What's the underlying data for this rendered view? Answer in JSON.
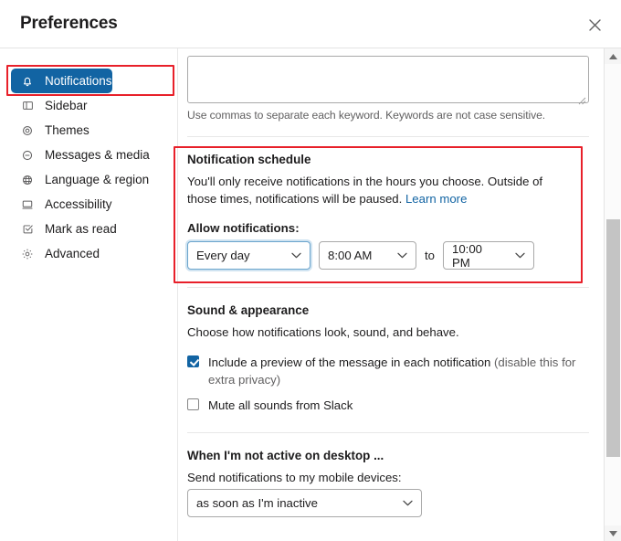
{
  "window": {
    "title": "Preferences",
    "close_icon": "close-icon"
  },
  "sidebar": {
    "items": [
      {
        "label": "Notifications",
        "icon": "bell-icon",
        "selected": true
      },
      {
        "label": "Sidebar",
        "icon": "sidebar-icon",
        "selected": false
      },
      {
        "label": "Themes",
        "icon": "eye-icon",
        "selected": false
      },
      {
        "label": "Messages & media",
        "icon": "message-icon",
        "selected": false
      },
      {
        "label": "Language & region",
        "icon": "globe-icon",
        "selected": false
      },
      {
        "label": "Accessibility",
        "icon": "keyboard-icon",
        "selected": false
      },
      {
        "label": "Mark as read",
        "icon": "checkmark-box-icon",
        "selected": false
      },
      {
        "label": "Advanced",
        "icon": "gear-icon",
        "selected": false
      }
    ]
  },
  "main": {
    "keywords": {
      "value": "",
      "placeholder": "",
      "hint": "Use commas to separate each keyword. Keywords are not case sensitive."
    },
    "notification_schedule": {
      "title": "Notification schedule",
      "description_part1": "You'll only receive notifications in the hours you choose. Outside of those times, notifications will be paused. ",
      "learn_more": "Learn more",
      "allow_label": "Allow notifications:",
      "days_value": "Every day",
      "start_time": "8:00 AM",
      "to_label": "to",
      "end_time": "10:00 PM"
    },
    "sound_appearance": {
      "title": "Sound & appearance",
      "description": "Choose how notifications look, sound, and behave.",
      "preview_label": "Include a preview of the message in each notification ",
      "preview_label_muted": "(disable this for extra privacy)",
      "preview_checked": true,
      "mute_label": "Mute all sounds from Slack",
      "mute_checked": false
    },
    "not_active": {
      "title": "When I'm not active on desktop ...",
      "description": "Send notifications to my mobile devices:",
      "mobile_value": "as soon as I'm inactive"
    }
  },
  "scrollbar": {
    "up_icon": "scroll-up-arrow-icon",
    "down_icon": "scroll-down-arrow-icon"
  },
  "annotations": {
    "highlight_color": "#e8202a",
    "accent_color": "#1264a3"
  }
}
